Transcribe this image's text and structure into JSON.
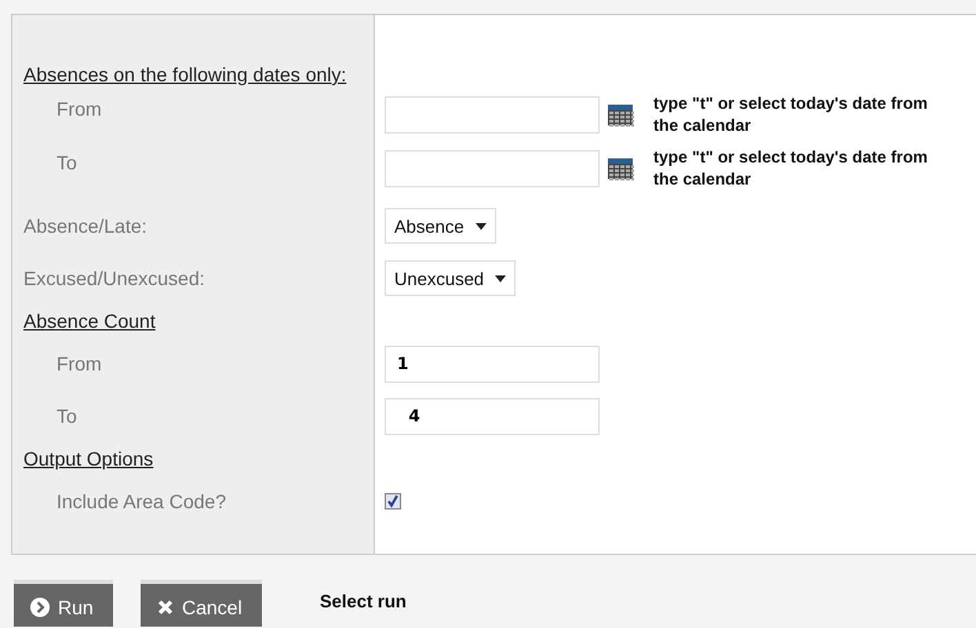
{
  "rows": [
    {
      "kind": "heading",
      "label": "Absences on the following dates only:",
      "children": [
        {
          "kind": "date",
          "label": "From",
          "hint": "type \"t\" or select today's date from the calendar"
        },
        {
          "kind": "date",
          "label": "To",
          "hint": "type \"t\" or select today's date from the calendar"
        }
      ]
    },
    {
      "kind": "select",
      "label": "Absence/Late:",
      "value": "Absence"
    },
    {
      "kind": "select",
      "label": "Excused/Unexcused:",
      "value": "Unexcused"
    },
    {
      "kind": "heading",
      "label": "Absence Count",
      "children": [
        {
          "kind": "number",
          "label": "From",
          "value": "1"
        },
        {
          "kind": "number",
          "label": "To",
          "value": "  4"
        }
      ]
    },
    {
      "kind": "heading",
      "label": "Output Options",
      "children": [
        {
          "kind": "checkbox",
          "label": "Include Area Code?",
          "checked": true
        }
      ]
    }
  ],
  "buttons": [
    {
      "kind": "run",
      "label": "Run"
    },
    {
      "kind": "cancel",
      "label": "Cancel"
    }
  ],
  "status": "Select run"
}
